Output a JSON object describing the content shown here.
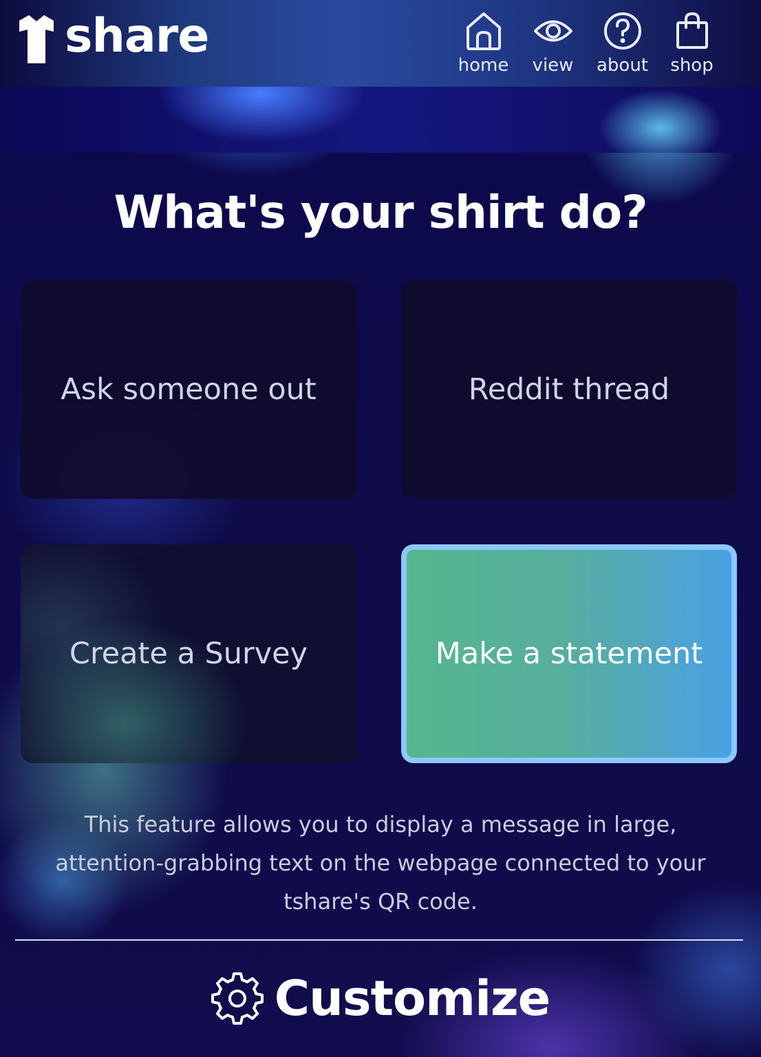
{
  "header": {
    "logo_text": "share",
    "nav": [
      {
        "label": "home",
        "icon": "home-icon"
      },
      {
        "label": "view",
        "icon": "eye-icon"
      },
      {
        "label": "about",
        "icon": "question-icon"
      },
      {
        "label": "shop",
        "icon": "shopping-bag-icon"
      }
    ]
  },
  "main": {
    "title": "What's your shirt do?",
    "options": [
      {
        "label": "Ask someone out",
        "selected": false
      },
      {
        "label": "Reddit thread",
        "selected": false
      },
      {
        "label": "Create a Survey",
        "selected": false
      },
      {
        "label": "Make a statement",
        "selected": true
      }
    ],
    "description": "This feature allows you to display a message in large, attention-grabbing text on the webpage connected to your tshare's QR code.",
    "customize_label": "Customize",
    "customize_icon": "gear-icon"
  },
  "colors": {
    "background": "#0e0a45",
    "selected_border": "#8cc8ff",
    "selected_gradient_start": "#55b78e",
    "selected_gradient_end": "#4aa1e6"
  }
}
